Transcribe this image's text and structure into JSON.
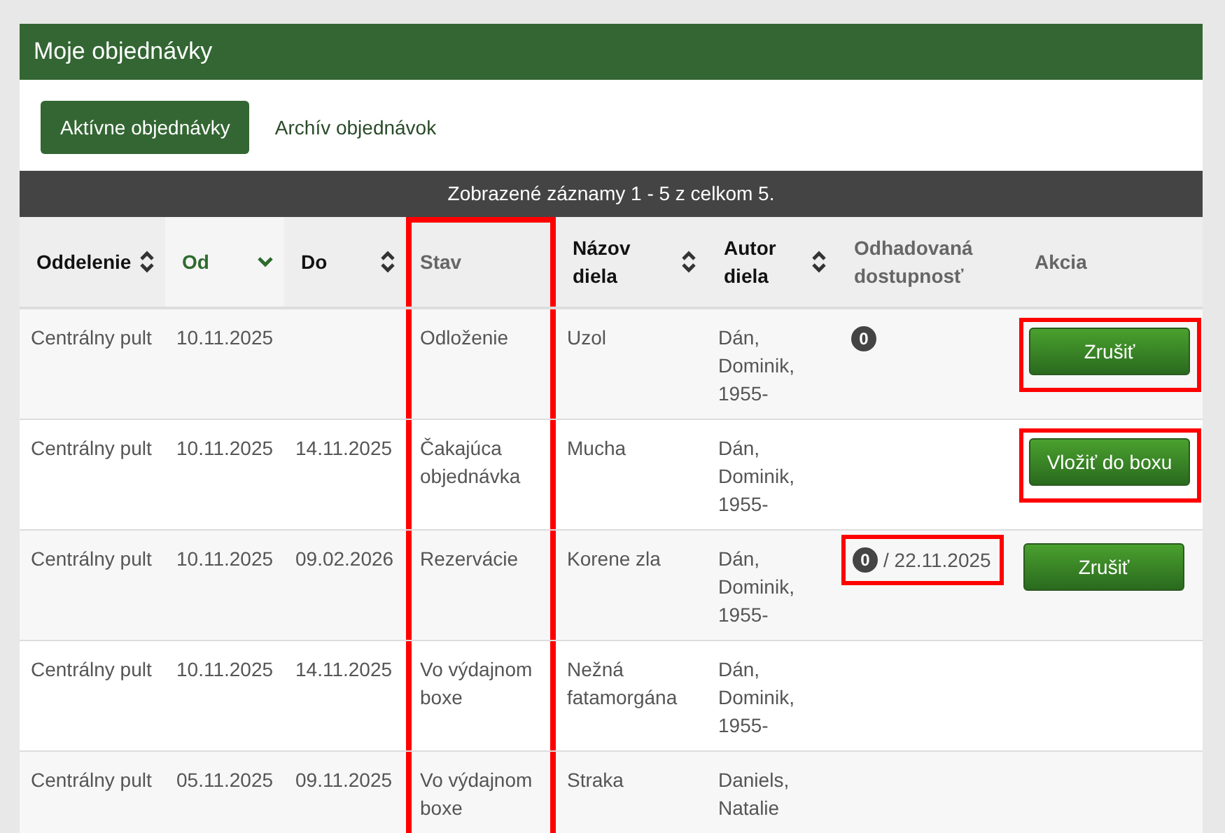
{
  "panel": {
    "title": "Moje objednávky"
  },
  "tabs": [
    {
      "label": "Aktívne objednávky",
      "selected": true
    },
    {
      "label": "Archív objednávok",
      "selected": false
    }
  ],
  "info_bar": "Zobrazené záznamy 1 - 5 z celkom 5.",
  "table": {
    "columns": [
      {
        "label": "Oddelenie",
        "sortable": true,
        "sorted": false,
        "highlighted": false
      },
      {
        "label": "Od",
        "sortable": true,
        "sorted": true,
        "highlighted": false
      },
      {
        "label": "Do",
        "sortable": true,
        "sorted": false,
        "highlighted": false
      },
      {
        "label": "Stav",
        "sortable": false,
        "sorted": false,
        "highlighted": true
      },
      {
        "label": "Názov diela",
        "sortable": true,
        "sorted": false,
        "highlighted": false
      },
      {
        "label": "Autor diela",
        "sortable": true,
        "sorted": false,
        "highlighted": false
      },
      {
        "label": "Odhadovaná dostupnosť",
        "sortable": false,
        "sorted": false,
        "highlighted": false
      },
      {
        "label": "Akcia",
        "sortable": false,
        "sorted": false,
        "highlighted": false
      }
    ],
    "rows": [
      {
        "department": "Centrálny pult",
        "from": "10.11.2025",
        "status": "Odloženie",
        "title": "Uzol",
        "author": "Dán, Dominik, 1955-",
        "availability": {
          "badge": "0",
          "highlighted": false
        },
        "action": {
          "label": "Zrušiť",
          "highlighted": true
        }
      },
      {
        "department": "Centrálny pult",
        "from": "10.11.2025",
        "to": "14.11.2025",
        "status": "Čakajúca objednávka",
        "title": "Mucha",
        "author": "Dán, Dominik, 1955-",
        "availability": null,
        "action": {
          "label": "Vložiť do boxu",
          "highlighted": true
        }
      },
      {
        "department": "Centrálny pult",
        "from": "10.11.2025",
        "to": "09.02.2026",
        "status": "Rezervácie",
        "title": "Korene zla",
        "author": "Dán, Dominik, 1955-",
        "availability": {
          "badge": "0",
          "date": "/ 22.11.2025",
          "highlighted": true
        },
        "action": {
          "label": "Zrušiť",
          "highlighted": false
        }
      },
      {
        "department": "Centrálny pult",
        "from": "10.11.2025",
        "to": "14.11.2025",
        "status": "Vo výdajnom boxe",
        "title": "Nežná fatamorgána",
        "author": "Dán, Dominik, 1955-",
        "availability": null,
        "action": null
      },
      {
        "department": "Centrálny pult",
        "from": "05.11.2025",
        "to": "09.11.2025",
        "status": "Vo výdajnom boxe",
        "title": "Straka",
        "author": "Daniels, Natalie",
        "availability": null,
        "action": null
      }
    ]
  }
}
